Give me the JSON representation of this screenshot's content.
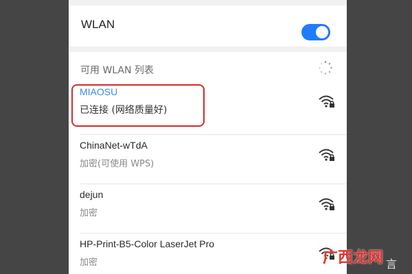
{
  "header": {
    "title": "WLAN",
    "toggle_on": true
  },
  "list": {
    "header": "可用 WLAN 列表",
    "networks": [
      {
        "ssid": "MIAOSU",
        "status": "已连接 (网络质量好)",
        "connected": true,
        "icon": "wifi-lock-icon"
      },
      {
        "ssid": "ChinaNet-wTdA",
        "status": "加密(可使用 WPS)",
        "connected": false,
        "icon": "wifi-lock-icon"
      },
      {
        "ssid": "dejun",
        "status": "加密",
        "connected": false,
        "icon": "wifi-lock-icon"
      },
      {
        "ssid": "HP-Print-B5-Color LaserJet Pro",
        "status": "加密",
        "connected": false,
        "icon": "wifi-lock-icon"
      }
    ]
  },
  "colors": {
    "accent": "#1f7bff",
    "connected_text": "#3a8ae6",
    "highlight": "#d32b2b"
  },
  "watermark": {
    "text": "广西龙网",
    "suffix": "言"
  }
}
